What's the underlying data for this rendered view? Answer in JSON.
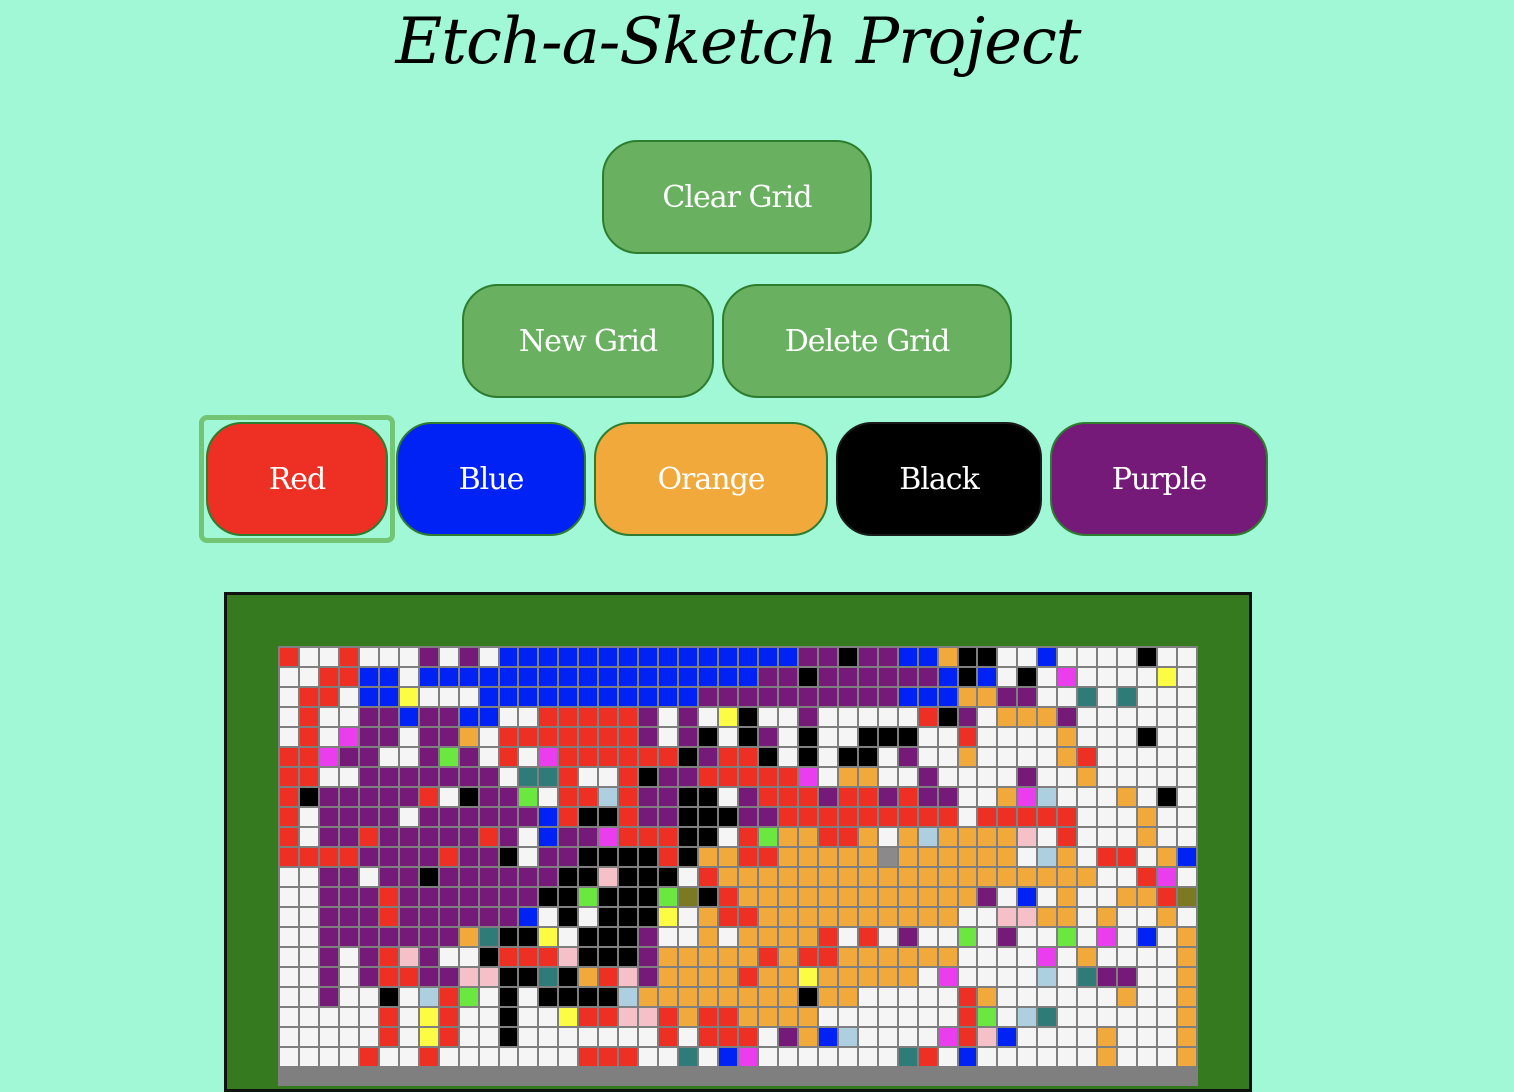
{
  "page": {
    "title": "Etch-a-Sketch Project"
  },
  "controls": {
    "clear_label": "Clear Grid",
    "new_label": "New Grid",
    "delete_label": "Delete Grid"
  },
  "colors": [
    {
      "id": "red",
      "label": "Red",
      "hex": "#ee3024"
    },
    {
      "id": "blue",
      "label": "Blue",
      "hex": "#0022f5"
    },
    {
      "id": "orange",
      "label": "Orange",
      "hex": "#f2a93b"
    },
    {
      "id": "black",
      "label": "Black",
      "hex": "#000000"
    },
    {
      "id": "purple",
      "label": "Purple",
      "hex": "#761a7a"
    }
  ],
  "selected_color": "red",
  "grid": {
    "columns": 46,
    "visible_rows": 21,
    "palette": {
      "W": "#f5f5f5",
      "R": "#ee3024",
      "B": "#0022f5",
      "O": "#f2a93b",
      "K": "#000000",
      "P": "#761a7a",
      "M": "#ea3ded",
      "Y": "#fdfc45",
      "G": "#6be83f",
      "T": "#2e7b77",
      "L": "#aecfe0",
      "N": "#f6c0c9",
      "S": "#8a8a8a",
      "V": "#7b7a22"
    },
    "rows": [
      "RWWRWWWPWPWBBBBBBBBBBBBBBBPPKPPBBOKKWWBWWWWKWW",
      "WWRRBBWBBBBBBBBBBBBBBBBBPPKPPPPPPBKBWKWMWWWWYW",
      "WRRWBBYWWWBBBBBBBBBBBPPPPPPPPPPBBBOOPPWWTWTWWW",
      "WRWWPPBPPBBWWRRRRRPWPWYKWWPWWWWWRKPWOOOPWWWWWW",
      "WRWMPPWPPOWRRRRRRRPWPKWKPWKWWKKKWWRWWWWOWWWKWW",
      "RRMPPWWPGPWRWMRRRRRRKPRRKWKWKKWPWWOWWWWORWWWWW",
      "RRWWPPPPPPPWTTRWWRKPPRRRRRMWOOWWPWWWWPWWOWWWWW",
      "RKPPPPPRWKPPGWRRLRPPKKWPRRRPRRPRPPWWOMLWWWOWKW",
      "RWPPPPWPPPPPPBRKKRPPKKKPPRRRRRRRRRWRRRRRWWWOWW",
      "RWPPRPPPPPRPWBPPMRRRKKWRGOORROWOLOOOONWRWWWOWW",
      "RRRRPPPPRPPKWPPKKKKRKOORROOOOOSOOOOOOWLOWRRWOBW",
      "WWPPWPPKPPPPPPKKNKKKWROOOOOOOOOOOOOOOOOOOWWRMWP",
      "WWPPPRPPPPPPPKKGKKKGVKROOOOOOOOOOOOPWBWOWWOORVLW",
      "WWPPPRPPPPPPBWKWKKKYWORROOOOOOOOOOWWNNOOWOWWOWWR",
      "WWPPPPPPPOTKKYWKKKPWWOWOOOORWRWPWWGWPWWGWMWBWOWW",
      "WWPWPRNPWWKRRRNKKKPOOOOORORROOOOOOWWWWMWOWWWWOWW",
      "WWPWPRRPPNNKKTKORNPOOOOROOYOOOOOWMWWWWLWTPPWWOWW",
      "WWPWWKWLRGWKWKKKKLOOOOOOOOKOOWWWWWROWWWWWWOWWOWW",
      "WWWWWRWYRWWKWWYRRNNRORROOOOWWWWWWWRGWLTWWWWWWOWW",
      "WWWWWRWYRWWKWWWWWWWRWRRRWPOBLWWWWMRNBWWWWOWWWOWW",
      "WWWWRWWRWWWWWWWRRRWWTWBMWWWWWWWTRWBWWWWWWOWWWOWW"
    ]
  }
}
